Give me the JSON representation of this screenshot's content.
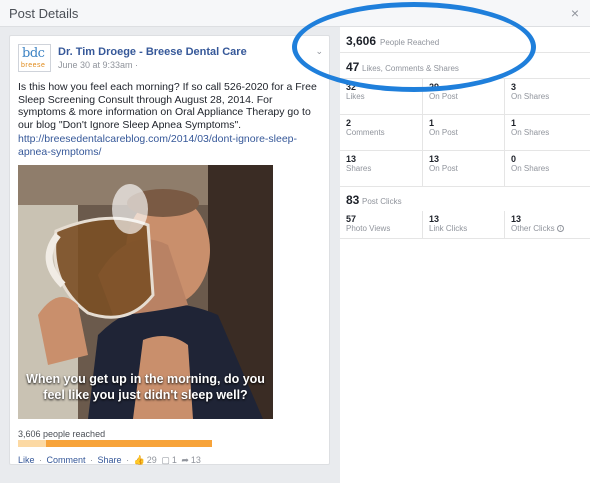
{
  "dialog": {
    "title": "Post Details",
    "close_glyph": "×"
  },
  "post": {
    "logo_top": "bdc",
    "logo_bottom": "breese",
    "page_name": "Dr. Tim Droege - Breese Dental Care",
    "date": "June 30 at 9:33am ·",
    "options_glyph": "⌄",
    "text": "Is this how you feel each morning? If so call 526-2020 for a Free Sleep Screening Consult through August 28, 2014. For symptoms & more information on Oral Appliance Therapy go to our blog \"Don't Ignore Sleep Apnea Symptoms\".",
    "link": "http://breesedentalcareblog.com/2014/03/dont-ignore-sleep-apnea-symptoms/",
    "image_caption": "When you get up in the morning, do you feel like you just didn't sleep well?",
    "reach_text": "3,606 people reached",
    "reach_fraction": 1.0,
    "actions": {
      "like": "Like",
      "comment": "Comment",
      "share": "Share",
      "likes_count": "29",
      "comments_count": "1",
      "shares_count": "13"
    }
  },
  "stats": {
    "people_reached": {
      "value": "3,606",
      "label": "People Reached"
    },
    "engagement": {
      "value": "47",
      "label": "Likes, Comments & Shares"
    },
    "rows": [
      [
        {
          "value": "32",
          "label": "Likes"
        },
        {
          "value": "29",
          "label": "On Post"
        },
        {
          "value": "3",
          "label": "On Shares"
        }
      ],
      [
        {
          "value": "2",
          "label": "Comments"
        },
        {
          "value": "1",
          "label": "On Post"
        },
        {
          "value": "1",
          "label": "On Shares"
        }
      ],
      [
        {
          "value": "13",
          "label": "Shares"
        },
        {
          "value": "13",
          "label": "On Post"
        },
        {
          "value": "0",
          "label": "On Shares"
        }
      ]
    ],
    "post_clicks": {
      "value": "83",
      "label": "Post Clicks"
    },
    "click_row": [
      {
        "value": "57",
        "label": "Photo Views"
      },
      {
        "value": "13",
        "label": "Link Clicks"
      },
      {
        "value": "13",
        "label": "Other Clicks"
      }
    ]
  },
  "colors": {
    "link": "#365899",
    "reach_bar": "#f7a33a",
    "highlight_ring": "#1f7fdb"
  }
}
